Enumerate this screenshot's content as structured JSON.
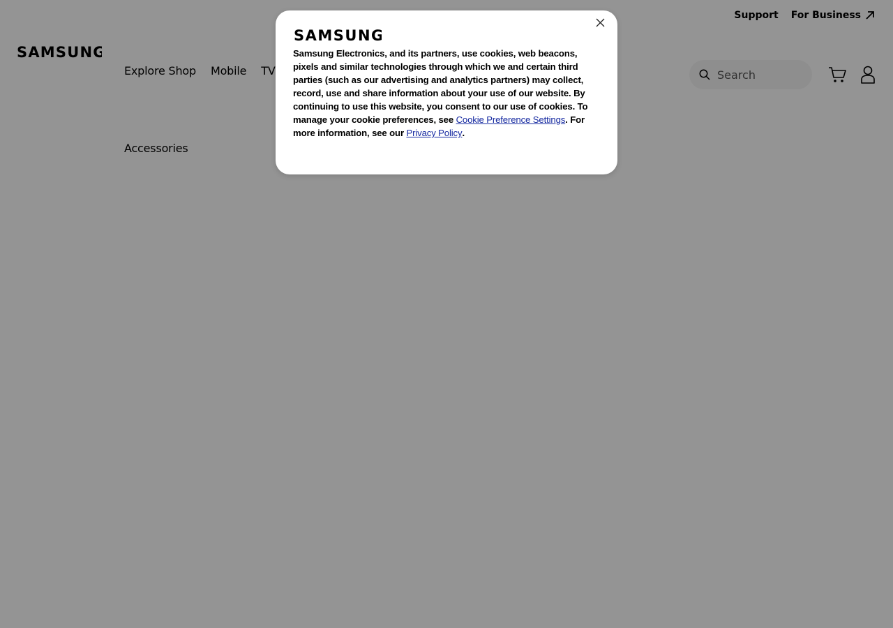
{
  "brand": {
    "logo_text": "SAMSUNG"
  },
  "utility_nav": {
    "support_label": "Support",
    "business_label": "For Business"
  },
  "main_nav": {
    "items": [
      {
        "label": "Explore Shop"
      },
      {
        "label": "Mobile"
      },
      {
        "label": "TV &"
      }
    ],
    "accessories_label": "Accessories"
  },
  "search": {
    "placeholder": "Search"
  },
  "icons": {
    "search": "search-icon",
    "cart": "cart-icon",
    "user": "user-icon",
    "external": "arrow-up-right-icon",
    "close": "close-icon"
  },
  "cookie_modal": {
    "logo_text": "SAMSUNG",
    "text_before_link": "Samsung Electronics, and its partners, use cookies, web beacons, pixels and similar technologies through which we and certain third parties (such as our advertising and analytics partners) may collect, record, use and share information about your use of our website. By continuing to use this website, you consent to our use of cookies. To manage your cookie preferences, see ",
    "cookie_settings_link": "Cookie Preference Settings",
    "text_middle": ". For more information, see our ",
    "privacy_link": "Privacy Policy",
    "text_end": "."
  },
  "colors": {
    "link": "#1428a0",
    "overlay": "rgba(0,0,0,0.42)",
    "search_bg": "#f4f4f4"
  }
}
